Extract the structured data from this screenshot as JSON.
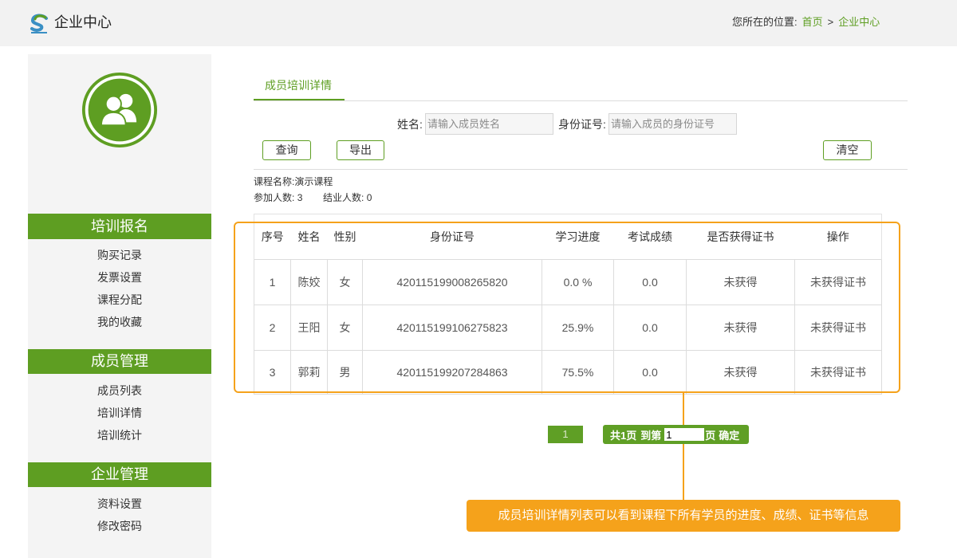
{
  "header": {
    "title": "企业中心",
    "breadcrumb_label": "您所在的位置:",
    "breadcrumb_home": "首页",
    "breadcrumb_separator": ">",
    "breadcrumb_current": "企业中心"
  },
  "sidebar": {
    "avatar_icon": "users-icon",
    "sections": [
      {
        "title": "培训报名",
        "items": [
          "购买记录",
          "发票设置",
          "课程分配",
          "我的收藏"
        ]
      },
      {
        "title": "成员管理",
        "items": [
          "成员列表",
          "培训详情",
          "培训统计"
        ]
      },
      {
        "title": "企业管理",
        "items": [
          "资料设置",
          "修改密码"
        ]
      }
    ]
  },
  "main": {
    "tab": "成员培训详情",
    "search": {
      "name_label": "姓名:",
      "name_placeholder": "请输入成员姓名",
      "id_label": "身份证号:",
      "id_placeholder": "请输入成员的身份证号",
      "query_button": "查询",
      "export_button": "导出",
      "clear_button": "清空"
    },
    "course": {
      "name_label": "课程名称:",
      "name": "演示课程",
      "participants_label": "参加人数:",
      "participants": "3",
      "graduates_label": "结业人数:",
      "graduates": "0"
    },
    "table": {
      "columns": [
        "序号",
        "姓名",
        "性别",
        "身份证号",
        "学习进度",
        "考试成绩",
        "是否获得证书",
        "操作"
      ],
      "rows": [
        [
          "1",
          "陈姣",
          "女",
          "420115199008265820",
          "0.0 %",
          "0.0",
          "未获得",
          "未获得证书"
        ],
        [
          "2",
          "王阳",
          "女",
          "420115199106275823",
          "25.9%",
          "0.0",
          "未获得",
          "未获得证书"
        ],
        [
          "3",
          "郭莉",
          "男",
          "420115199207284863",
          "75.5%",
          "0.0",
          "未获得",
          "未获得证书"
        ]
      ]
    },
    "pagination": {
      "current": "1",
      "total": "共1页",
      "goto_prefix": "到第",
      "goto_value": "1",
      "goto_suffix": "页",
      "confirm": "确定"
    },
    "callout": "成员培训详情列表可以看到课程下所有学员的进度、成绩、证书等信息"
  },
  "colors": {
    "accent": "#5e9e22",
    "highlight": "#f5a21b",
    "header_bg": "#f2f2f2",
    "sidebar_bg": "#f4f4f4"
  }
}
